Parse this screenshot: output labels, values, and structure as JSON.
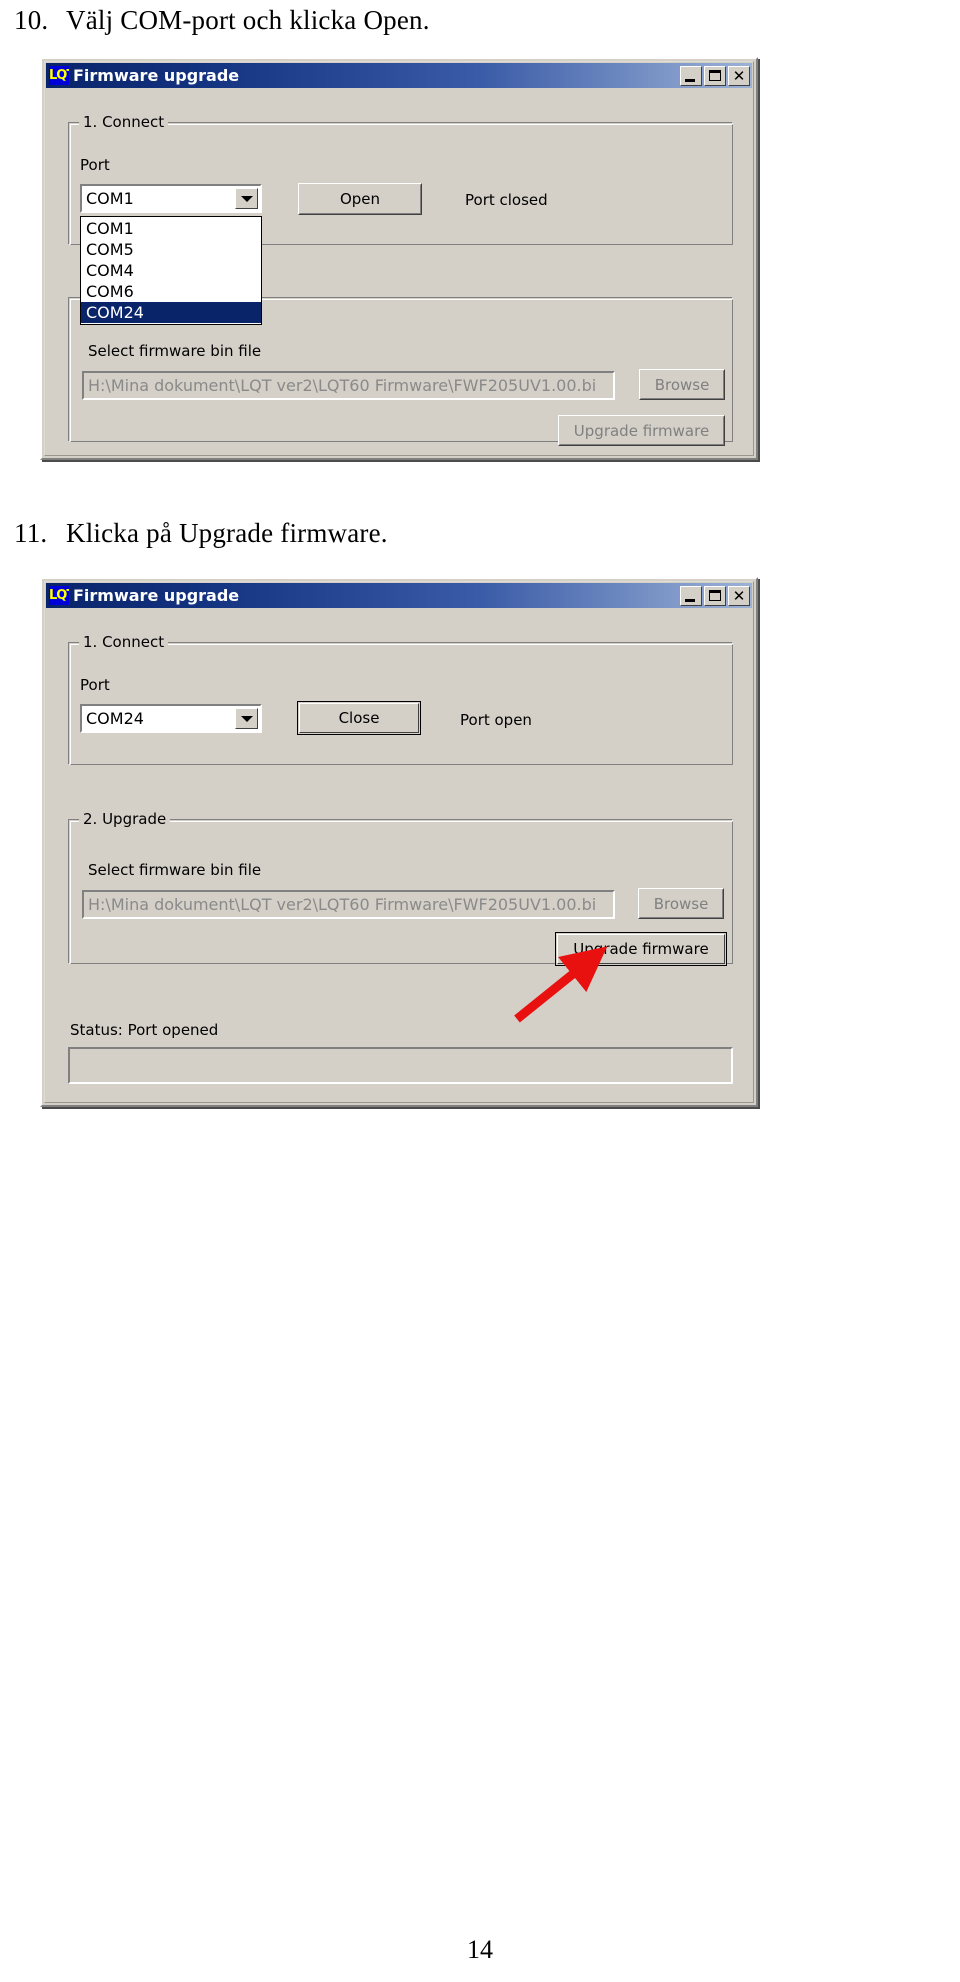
{
  "document": {
    "steps": [
      {
        "number": "10.",
        "text": "Välj COM-port och klicka Open."
      },
      {
        "number": "11.",
        "text": "Klicka på Upgrade firmware."
      }
    ],
    "page_number": "14"
  },
  "dialog1": {
    "title": "Firmware upgrade",
    "icon_text": "LQT",
    "titlebar_buttons": {
      "minimize": "_",
      "maximize": "□",
      "close": "✕"
    },
    "group_connect": {
      "label": "1. Connect",
      "port_label": "Port",
      "combo_value": "COM1",
      "dropdown_open": true,
      "dropdown_items": [
        "COM1",
        "COM5",
        "COM4",
        "COM6",
        "COM24"
      ],
      "dropdown_selected": "COM24",
      "open_button": "Open",
      "status": "Port closed"
    },
    "group_upgrade": {
      "file_label": "Select firmware bin file",
      "file_path": "H:\\Mina dokument\\LQT ver2\\LQT60 Firmware\\FWF205UV1.00.bi",
      "browse_button": "Browse",
      "upgrade_button": "Upgrade firmware"
    }
  },
  "dialog2": {
    "title": "Firmware upgrade",
    "icon_text": "LQT",
    "titlebar_buttons": {
      "minimize": "_",
      "maximize": "□",
      "close": "✕"
    },
    "group_connect": {
      "label": "1. Connect",
      "port_label": "Port",
      "combo_value": "COM24",
      "close_button": "Close",
      "status": "Port open"
    },
    "group_upgrade": {
      "label": "2. Upgrade",
      "file_label": "Select firmware bin file",
      "file_path": "H:\\Mina dokument\\LQT ver2\\LQT60 Firmware\\FWF205UV1.00.bi",
      "browse_button": "Browse",
      "upgrade_button": "Upgrade firmware"
    },
    "status_label": "Status: Port opened"
  },
  "annotation": {
    "arrow_color": "#e8110f",
    "points_to": "upgrade-firmware-button"
  },
  "colors": {
    "dialog_face": "#d4d0c8",
    "titlebar_start": "#0a246a",
    "titlebar_end": "#9cb2d6",
    "highlight": "#0a246a",
    "arrow_red": "#e8110f"
  }
}
